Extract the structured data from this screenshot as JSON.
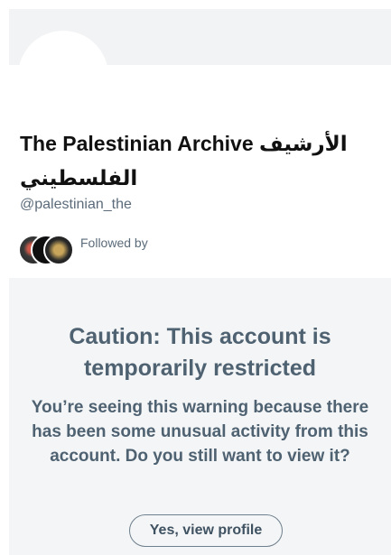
{
  "profile": {
    "name": "The Palestinian Archive الأرشيف الفلسطيني",
    "handle": "@palestinian_the",
    "followed_by_label": "Followed by"
  },
  "restriction": {
    "title": "Caution: This account is temporarily restricted",
    "message": "You’re seeing this warning because there has been some unusual activity from this account. Do you still want to view it?",
    "view_button_label": "Yes, view profile"
  },
  "colors": {
    "banner": "#f2f3f4",
    "caution_background": "#f4f5f6",
    "caution_text": "#4f6272"
  }
}
